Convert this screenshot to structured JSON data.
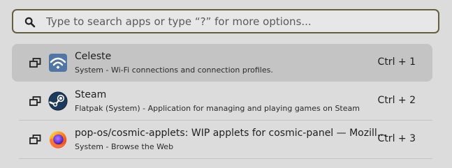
{
  "search": {
    "placeholder": "Type to search apps or type “?” for more options...",
    "value": "",
    "icon": "search-icon"
  },
  "results": [
    {
      "title": "Celeste",
      "description": "System - Wi-Fi connections and connection profiles.",
      "shortcut": "Ctrl + 1",
      "icon": "wifi-app-icon",
      "selected": true
    },
    {
      "title": "Steam",
      "description": "Flatpak (System) - Application for managing and playing games on Steam",
      "shortcut": "Ctrl + 2",
      "icon": "steam-icon",
      "selected": false
    },
    {
      "title": "pop-os/cosmic-applets: WIP applets for cosmic-panel — Mozill...",
      "description": "System - Browse the Web",
      "shortcut": "Ctrl + 3",
      "icon": "firefox-icon",
      "selected": false
    }
  ],
  "colors": {
    "background": "#dcdcdc",
    "search_border": "#645f40",
    "selected_row": "#c4c4c4"
  }
}
